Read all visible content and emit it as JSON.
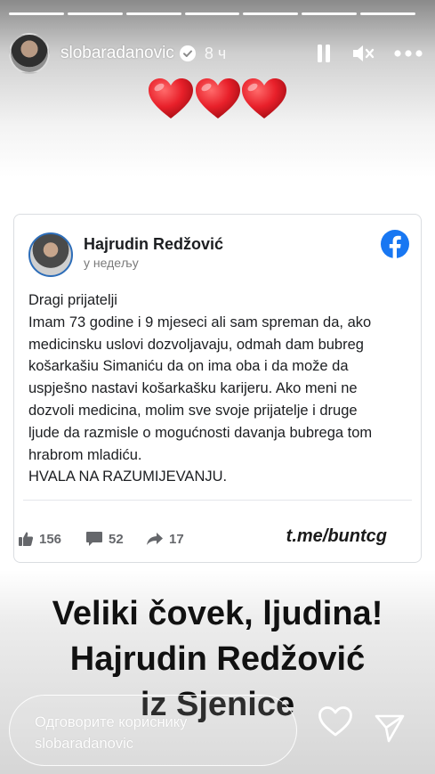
{
  "story": {
    "progress_segments": 7,
    "username": "slobaradanovic",
    "time": "8 ч",
    "icons": [
      "avatar",
      "verified-badge-icon",
      "pause-icon",
      "mute-icon",
      "more-icon"
    ]
  },
  "post": {
    "author": "Hajrudin Redžović",
    "date": "у недељу",
    "body": [
      "Dragi prijatelji",
      "Imam 73 godine i 9 mjeseci ali sam spreman da, ako",
      "medicinsku uslovi dozvoljavaju, odmah dam bubreg",
      "košarkašiu Simaniću da on ima oba i da može da",
      "uspješno nastavi košarkašku karijeru. Ako meni ne",
      "dozvoli medicina, molim sve svoje prijatelje i druge",
      "ljude da razmisle o mogućnosti davanja bubrega tom",
      "hrabrom mladiću.",
      "HVALA NA RAZUMIJEVANJU."
    ],
    "likes": "156",
    "comments": "52",
    "shares": "17",
    "link": "t.me/buntcg"
  },
  "caption": [
    "Veliki čovek, ljudina!",
    "Hajrudin Redžović",
    "iz Sjenice"
  ],
  "reply": {
    "placeholder": "Одговорите кориснику slobaradanovic"
  },
  "colors": {
    "heart_red": "#e8202a",
    "facebook_blue": "#1877f2",
    "avatar_ring": "#2d6db8"
  }
}
